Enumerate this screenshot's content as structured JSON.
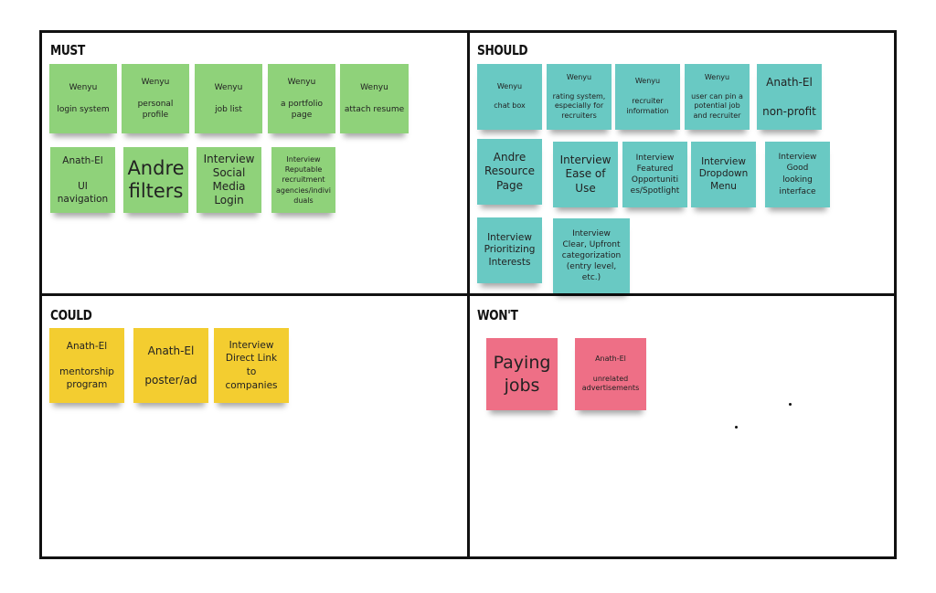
{
  "board": {
    "quadrants": {
      "must": {
        "title": "MUST",
        "color": "#8fd27a"
      },
      "should": {
        "title": "SHOULD",
        "color": "#69c9c3"
      },
      "could": {
        "title": "COULD",
        "color": "#f3cd30"
      },
      "wont": {
        "title": "WON'T",
        "color": "#ee6f86"
      }
    },
    "must_notes": [
      "Wenyu\n\nlogin system",
      "Wenyu\n\npersonal\nprofile",
      "Wenyu\n\njob list",
      "Wenyu\n\na portfolio\npage",
      "Wenyu\n\nattach resume",
      "Anath-El\n\nUI\nnavigation",
      "Andre\nfilters",
      "Interview\nSocial\nMedia\nLogin",
      "Interview\nReputable\nrecruitment\nagencies/indivi\nduals"
    ],
    "should_notes": [
      "Wenyu\n\nchat box",
      "Wenyu\n\nrating system,\nespecially for\nrecruiters",
      "Wenyu\n\nrecruiter\ninformation",
      "Wenyu\n\nuser can pin a\npotential job\nand recruiter",
      "Anath-El\n\nnon-profit",
      "Andre\nResource\nPage",
      "Interview\nEase of\nUse",
      "Interview\nFeatured\nOpportuniti\nes/Spotlight",
      "Interview\nDropdown\nMenu",
      "Interview\nGood\nlooking\ninterface",
      "Interview\nPrioritizing\nInterests",
      "Interview\nClear, Upfront\ncategorization\n(entry level,\netc.)"
    ],
    "could_notes": [
      "Anath-El\n\nmentorship\nprogram",
      "Anath-El\n\nposter/ad",
      "Interview\nDirect Link\nto\ncompanies"
    ],
    "wont_notes": [
      "Paying\njobs",
      "Anath-El\n\nunrelated\nadvertisements"
    ]
  }
}
